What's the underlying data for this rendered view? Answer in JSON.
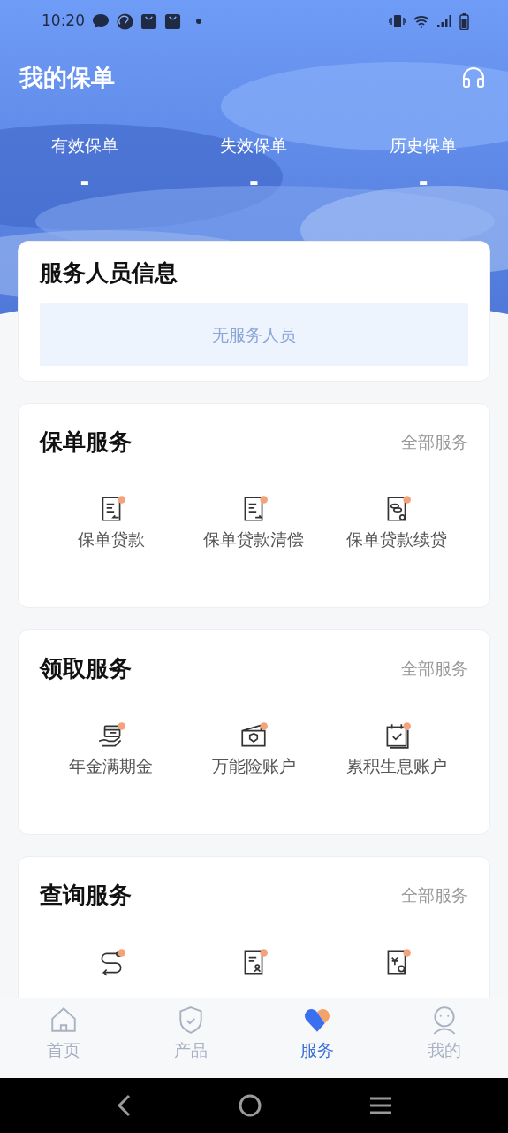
{
  "status_bar": {
    "time": "10:20"
  },
  "header": {
    "title": "我的保单"
  },
  "stats": [
    {
      "label": "有效保单",
      "value": "-"
    },
    {
      "label": "失效保单",
      "value": "-"
    },
    {
      "label": "历史保单",
      "value": "-"
    }
  ],
  "staff_card": {
    "title": "服务人员信息",
    "empty_text": "无服务人员"
  },
  "sections": [
    {
      "title": "保单服务",
      "more": "全部服务",
      "items": [
        {
          "kind": "loan",
          "label": "保单贷款"
        },
        {
          "kind": "repay",
          "label": "保单贷款清偿"
        },
        {
          "kind": "renew",
          "label": "保单贷款续贷"
        }
      ]
    },
    {
      "title": "领取服务",
      "more": "全部服务",
      "items": [
        {
          "kind": "annuity",
          "label": "年金满期金"
        },
        {
          "kind": "wallet",
          "label": "万能险账户"
        },
        {
          "kind": "calendar",
          "label": "累积生息账户"
        }
      ]
    },
    {
      "title": "查询服务",
      "more": "全部服务",
      "items": [
        {
          "kind": "route"
        },
        {
          "kind": "account"
        },
        {
          "kind": "dividend"
        }
      ]
    }
  ],
  "tab_bar": [
    {
      "label": "首页",
      "selected": false
    },
    {
      "label": "产品",
      "selected": false
    },
    {
      "label": "服务",
      "selected": true
    },
    {
      "label": "我的",
      "selected": false
    }
  ]
}
